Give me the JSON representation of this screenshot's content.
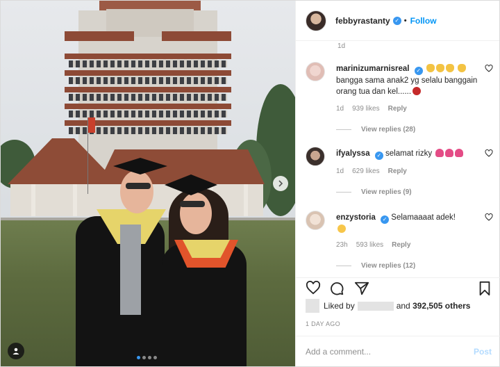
{
  "header": {
    "username": "febbyrastanty",
    "separator": "•",
    "follow_label": "Follow"
  },
  "top_timestamp": "1d",
  "comments": [
    {
      "username": "marinizumarnisreal",
      "text": "bangga sama anak2 yg selalu banggain orang tua dan kel......",
      "time": "1d",
      "likes": "939 likes",
      "reply_label": "Reply",
      "view_replies": "View replies (28)"
    },
    {
      "username": "ifyalyssa",
      "text": "selamat rizky",
      "time": "1d",
      "likes": "629 likes",
      "reply_label": "Reply",
      "view_replies": "View replies (9)"
    },
    {
      "username": "enzystoria",
      "text": "Selamaaaat adek!",
      "time": "23h",
      "likes": "593 likes",
      "reply_label": "Reply",
      "view_replies": "View replies (12)"
    }
  ],
  "likes": {
    "prefix": "Liked by",
    "middle": "and",
    "count": "392,505 others"
  },
  "post_time": "1 DAY AGO",
  "add_comment": {
    "placeholder": "Add a comment...",
    "post_label": "Post"
  },
  "carousel": {
    "slides": 4,
    "active_index": 0
  },
  "colors": {
    "accent": "#0095f6",
    "verified": "#3897f0",
    "post_disabled": "#b3dbff"
  }
}
